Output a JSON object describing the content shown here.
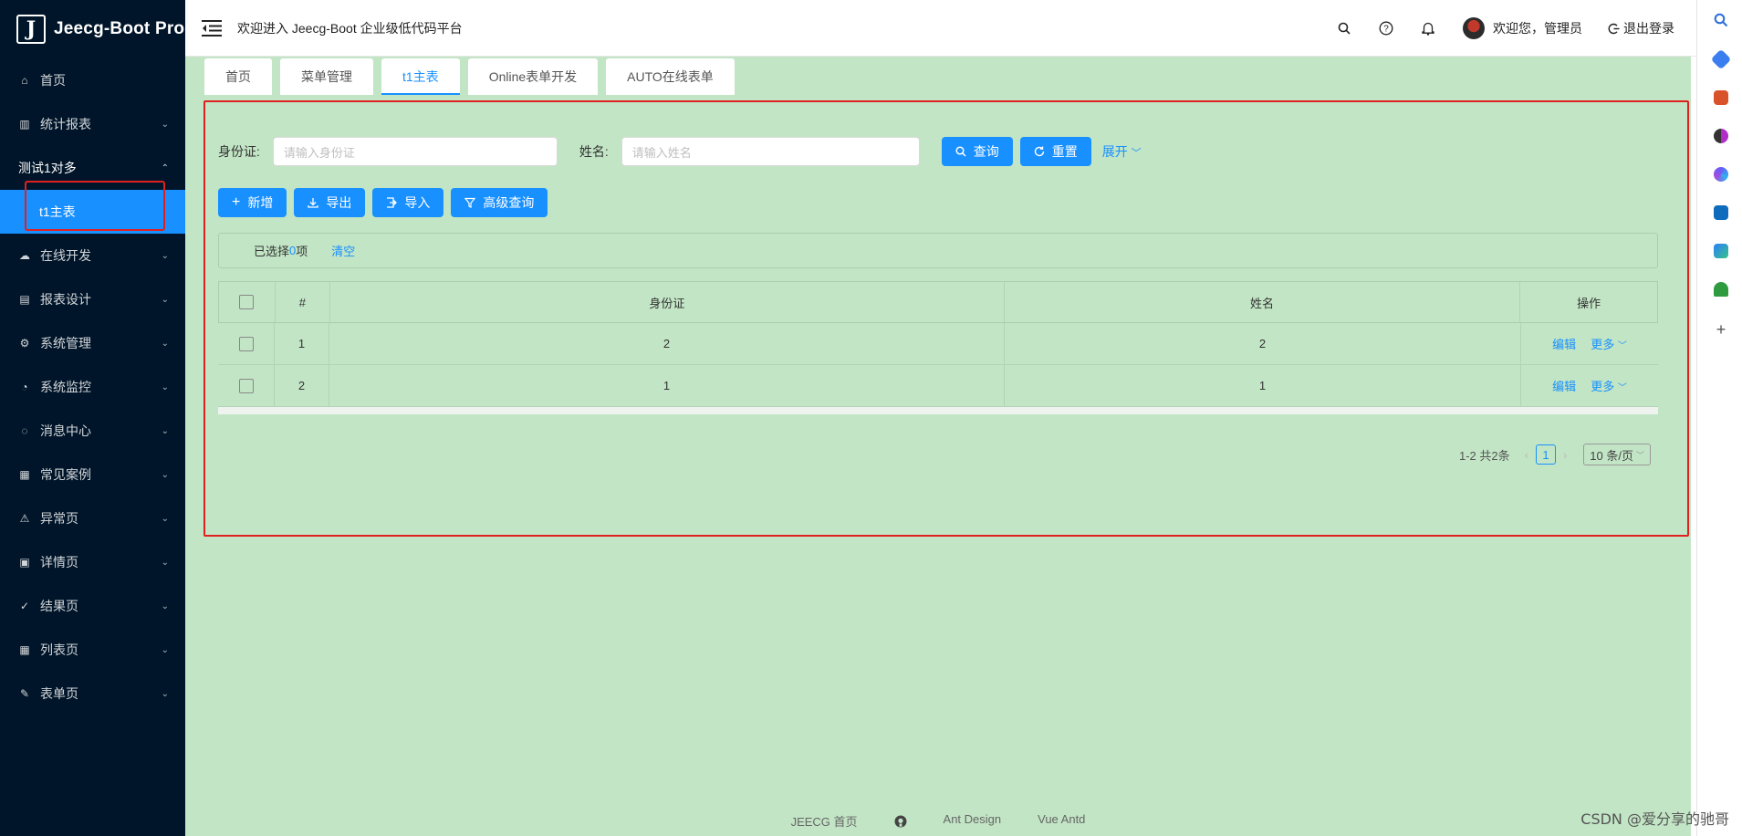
{
  "app": {
    "logo_letter": "J",
    "title": "Jeecg-Boot Pro"
  },
  "sidebar": {
    "items": [
      {
        "label": "首页",
        "icon": "home-icon",
        "glyph": "⌂",
        "chevron": ""
      },
      {
        "label": "统计报表",
        "icon": "chart-icon",
        "glyph": "▥",
        "chevron": "⌄"
      },
      {
        "label": "测试1对多",
        "icon": "",
        "glyph": "",
        "chevron": "⌃"
      },
      {
        "label": "t1主表",
        "icon": "",
        "glyph": "",
        "chevron": ""
      },
      {
        "label": "在线开发",
        "icon": "cloud-icon",
        "glyph": "☁",
        "chevron": "⌄"
      },
      {
        "label": "报表设计",
        "icon": "area-chart-icon",
        "glyph": "▤",
        "chevron": "⌄"
      },
      {
        "label": "系统管理",
        "icon": "setting-icon",
        "glyph": "⚙",
        "chevron": "⌄"
      },
      {
        "label": "系统监控",
        "icon": "dashboard-icon",
        "glyph": "◔",
        "chevron": "⌄"
      },
      {
        "label": "消息中心",
        "icon": "message-icon",
        "glyph": "◌",
        "chevron": "⌄"
      },
      {
        "label": "常见案例",
        "icon": "qrcode-icon",
        "glyph": "▦",
        "chevron": "⌄"
      },
      {
        "label": "异常页",
        "icon": "warning-icon",
        "glyph": "⚠",
        "chevron": "⌄"
      },
      {
        "label": "详情页",
        "icon": "profile-icon",
        "glyph": "▣",
        "chevron": "⌄"
      },
      {
        "label": "结果页",
        "icon": "check-circle-icon",
        "glyph": "✓",
        "chevron": "⌄"
      },
      {
        "label": "列表页",
        "icon": "table-icon",
        "glyph": "▦",
        "chevron": "⌄"
      },
      {
        "label": "表单页",
        "icon": "form-icon",
        "glyph": "✎",
        "chevron": "⌄"
      }
    ]
  },
  "header": {
    "welcome": "欢迎进入 Jeecg-Boot 企业级低代码平台",
    "user": "欢迎您，管理员",
    "logout": "退出登录"
  },
  "tabs": [
    {
      "label": "首页",
      "active": false
    },
    {
      "label": "菜单管理",
      "active": false
    },
    {
      "label": "t1主表",
      "active": true
    },
    {
      "label": "Online表单开发",
      "active": false
    },
    {
      "label": "AUTO在线表单",
      "active": false
    }
  ],
  "search": {
    "id_label": "身份证:",
    "id_placeholder": "请输入身份证",
    "name_label": "姓名:",
    "name_placeholder": "请输入姓名",
    "query": "查询",
    "reset": "重置",
    "expand": "展开"
  },
  "actions": {
    "add": "新增",
    "export": "导出",
    "import": "导入",
    "advanced": "高级查询"
  },
  "selection": {
    "prefix": "已选择 ",
    "count": "0",
    "suffix": "项",
    "clear": "清空"
  },
  "table": {
    "columns": [
      "#",
      "身份证",
      "姓名",
      "操作"
    ],
    "rows": [
      {
        "index": "1",
        "id_card": "2",
        "name": "2"
      },
      {
        "index": "2",
        "id_card": "1",
        "name": "1"
      }
    ],
    "edit": "编辑",
    "more": "更多"
  },
  "pagination": {
    "summary": "1-2 共2条",
    "current": "1",
    "page_size": "10 条/页"
  },
  "footer": {
    "home": "JEECG 首页",
    "antd": "Ant Design",
    "vue": "Vue Antd"
  },
  "watermark": "CSDN @爱分享的驰哥",
  "colors": {
    "accent": "#1890ff",
    "sidebar_bg": "#001529",
    "content_bg": "#c2e5c5",
    "highlight_border": "#e02020"
  }
}
